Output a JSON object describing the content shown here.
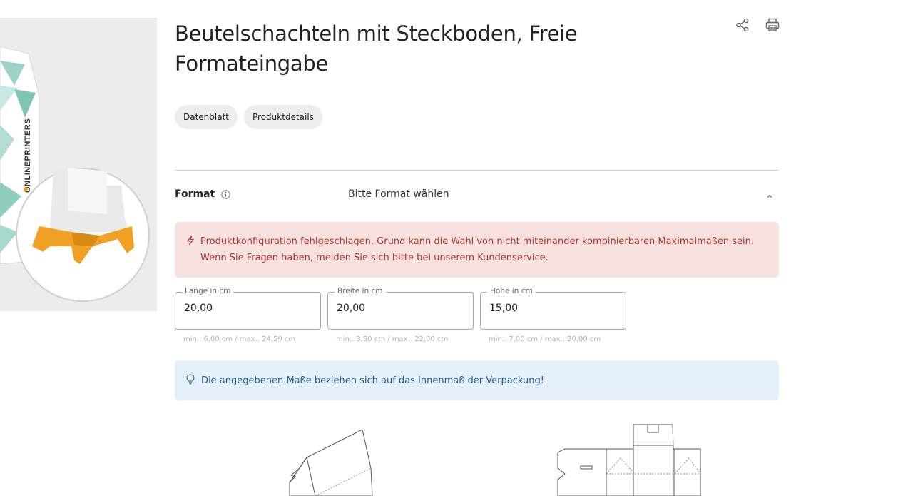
{
  "product": {
    "title": "Beutelschachteln mit Steckboden, Freie Formateingabe",
    "image_brand": "ONLINEPRINTERS"
  },
  "toolbar": {
    "share_icon": "share-icon",
    "print_icon": "print-icon"
  },
  "chips": [
    {
      "label": "Datenblatt"
    },
    {
      "label": "Produktdetails"
    }
  ],
  "format": {
    "label": "Format",
    "value": "Bitte Format wählen"
  },
  "error": {
    "message": "Produktkonfiguration fehlgeschlagen. Grund kann die Wahl von nicht miteinander kombinierbaren Maximalmaßen sein. Wenn Sie Fragen haben, melden Sie sich bitte bei unserem Kundenservice."
  },
  "fields": [
    {
      "label": "Länge in cm",
      "value": "20,00",
      "hint": "min.. 6,00 cm / max.. 24,50 cm"
    },
    {
      "label": "Breite in cm",
      "value": "20,00",
      "hint": "min.. 3,50 cm / max.. 22,00 cm"
    },
    {
      "label": "Höhe in cm",
      "value": "15,00",
      "hint": "min.. 7,00 cm / max.. 20,00 cm"
    }
  ],
  "info": {
    "message": "Die angegebenen Maße beziehen sich auf das Innenmaß der Verpackung!"
  },
  "colors": {
    "error_bg": "#f7e2e0",
    "error_text": "#b0352f",
    "info_bg": "#e4f1fb",
    "info_text": "#1f5c94",
    "accent_orange": "#f0a024"
  }
}
